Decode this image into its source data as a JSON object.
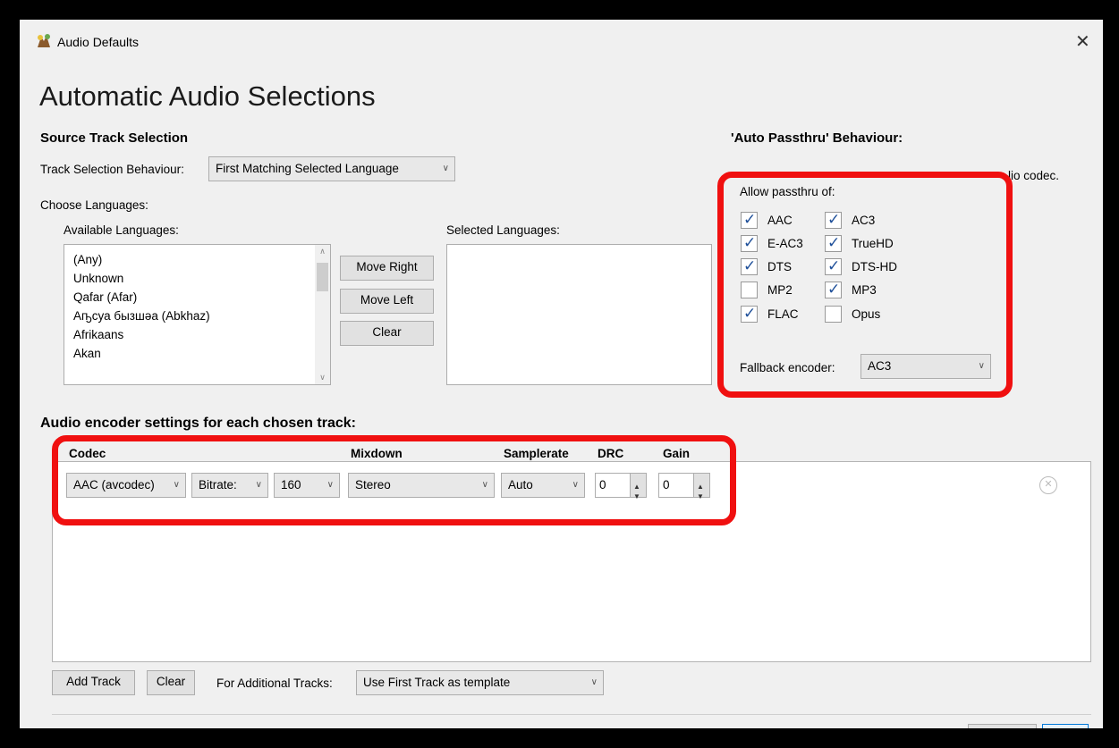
{
  "window": {
    "title": "Audio Defaults",
    "close_glyph": "✕"
  },
  "header": {
    "title": "Automatic Audio Selections"
  },
  "source": {
    "heading": "Source Track Selection",
    "behaviour_label": "Track Selection Behaviour:",
    "behaviour_value": "First Matching Selected Language",
    "choose_label": "Choose Languages:",
    "available_label": "Available Languages:",
    "selected_label": "Selected Languages:",
    "available": [
      "(Any)",
      "Unknown",
      "Qafar (Afar)",
      "Аҧсуа бызшәа (Abkhaz)",
      "Afrikaans",
      "Akan"
    ],
    "buttons": {
      "move_right": "Move Right",
      "move_left": "Move Left",
      "clear": "Clear"
    }
  },
  "passthru": {
    "heading": "'Auto Passthru' Behaviour:",
    "partial_text": "lio codec.",
    "allow_label": "Allow passthru of:",
    "options": [
      {
        "label": "AAC",
        "checked": true
      },
      {
        "label": "AC3",
        "checked": true
      },
      {
        "label": "E-AC3",
        "checked": true
      },
      {
        "label": "TrueHD",
        "checked": true
      },
      {
        "label": "DTS",
        "checked": true
      },
      {
        "label": "DTS-HD",
        "checked": true
      },
      {
        "label": "MP2",
        "checked": false
      },
      {
        "label": "MP3",
        "checked": true
      },
      {
        "label": "FLAC",
        "checked": true
      },
      {
        "label": "Opus",
        "checked": false
      }
    ],
    "fallback_label": "Fallback encoder:",
    "fallback_value": "AC3"
  },
  "encoder": {
    "heading": "Audio encoder settings for each chosen track:",
    "columns": {
      "codec": "Codec",
      "mixdown": "Mixdown",
      "samplerate": "Samplerate",
      "drc": "DRC",
      "gain": "Gain"
    },
    "track": {
      "codec": "AAC (avcodec)",
      "bitrate_mode": "Bitrate:",
      "bitrate": "160",
      "mixdown": "Stereo",
      "samplerate": "Auto",
      "drc": "0",
      "gain": "0"
    }
  },
  "footer": {
    "add_track": "Add Track",
    "clear": "Clear",
    "additional_label": "For Additional Tracks:",
    "additional_value": "Use First Track as template"
  },
  "colors": {
    "highlight": "#f01010",
    "check": "#1e4f99"
  }
}
